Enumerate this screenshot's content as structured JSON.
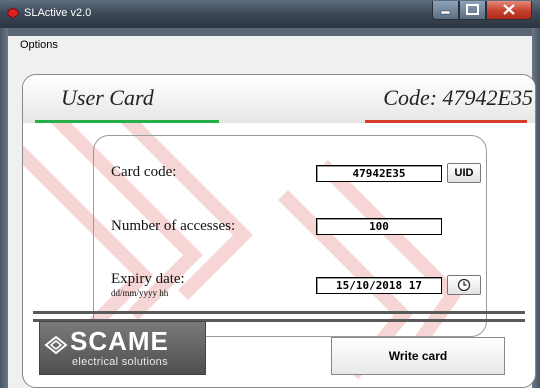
{
  "window": {
    "title": "SLActive v2.0"
  },
  "menu": {
    "options": "Options"
  },
  "header": {
    "title": "User Card",
    "code_label": "Code: 47942E35"
  },
  "form": {
    "card_code": {
      "label": "Card code:",
      "value": "47942E35",
      "button": "UID"
    },
    "accesses": {
      "label": "Number of accesses:",
      "value": "100"
    },
    "expiry": {
      "label": "Expiry date:",
      "hint": "dd/mm/yyyy hh",
      "value": "15/10/2018 17",
      "icon": "clock-icon"
    }
  },
  "logo": {
    "name": "SCAME",
    "tagline": "electrical solutions"
  },
  "actions": {
    "write": "Write card"
  },
  "colors": {
    "accent_green": "#27b04a",
    "accent_red": "#d83a2c"
  }
}
